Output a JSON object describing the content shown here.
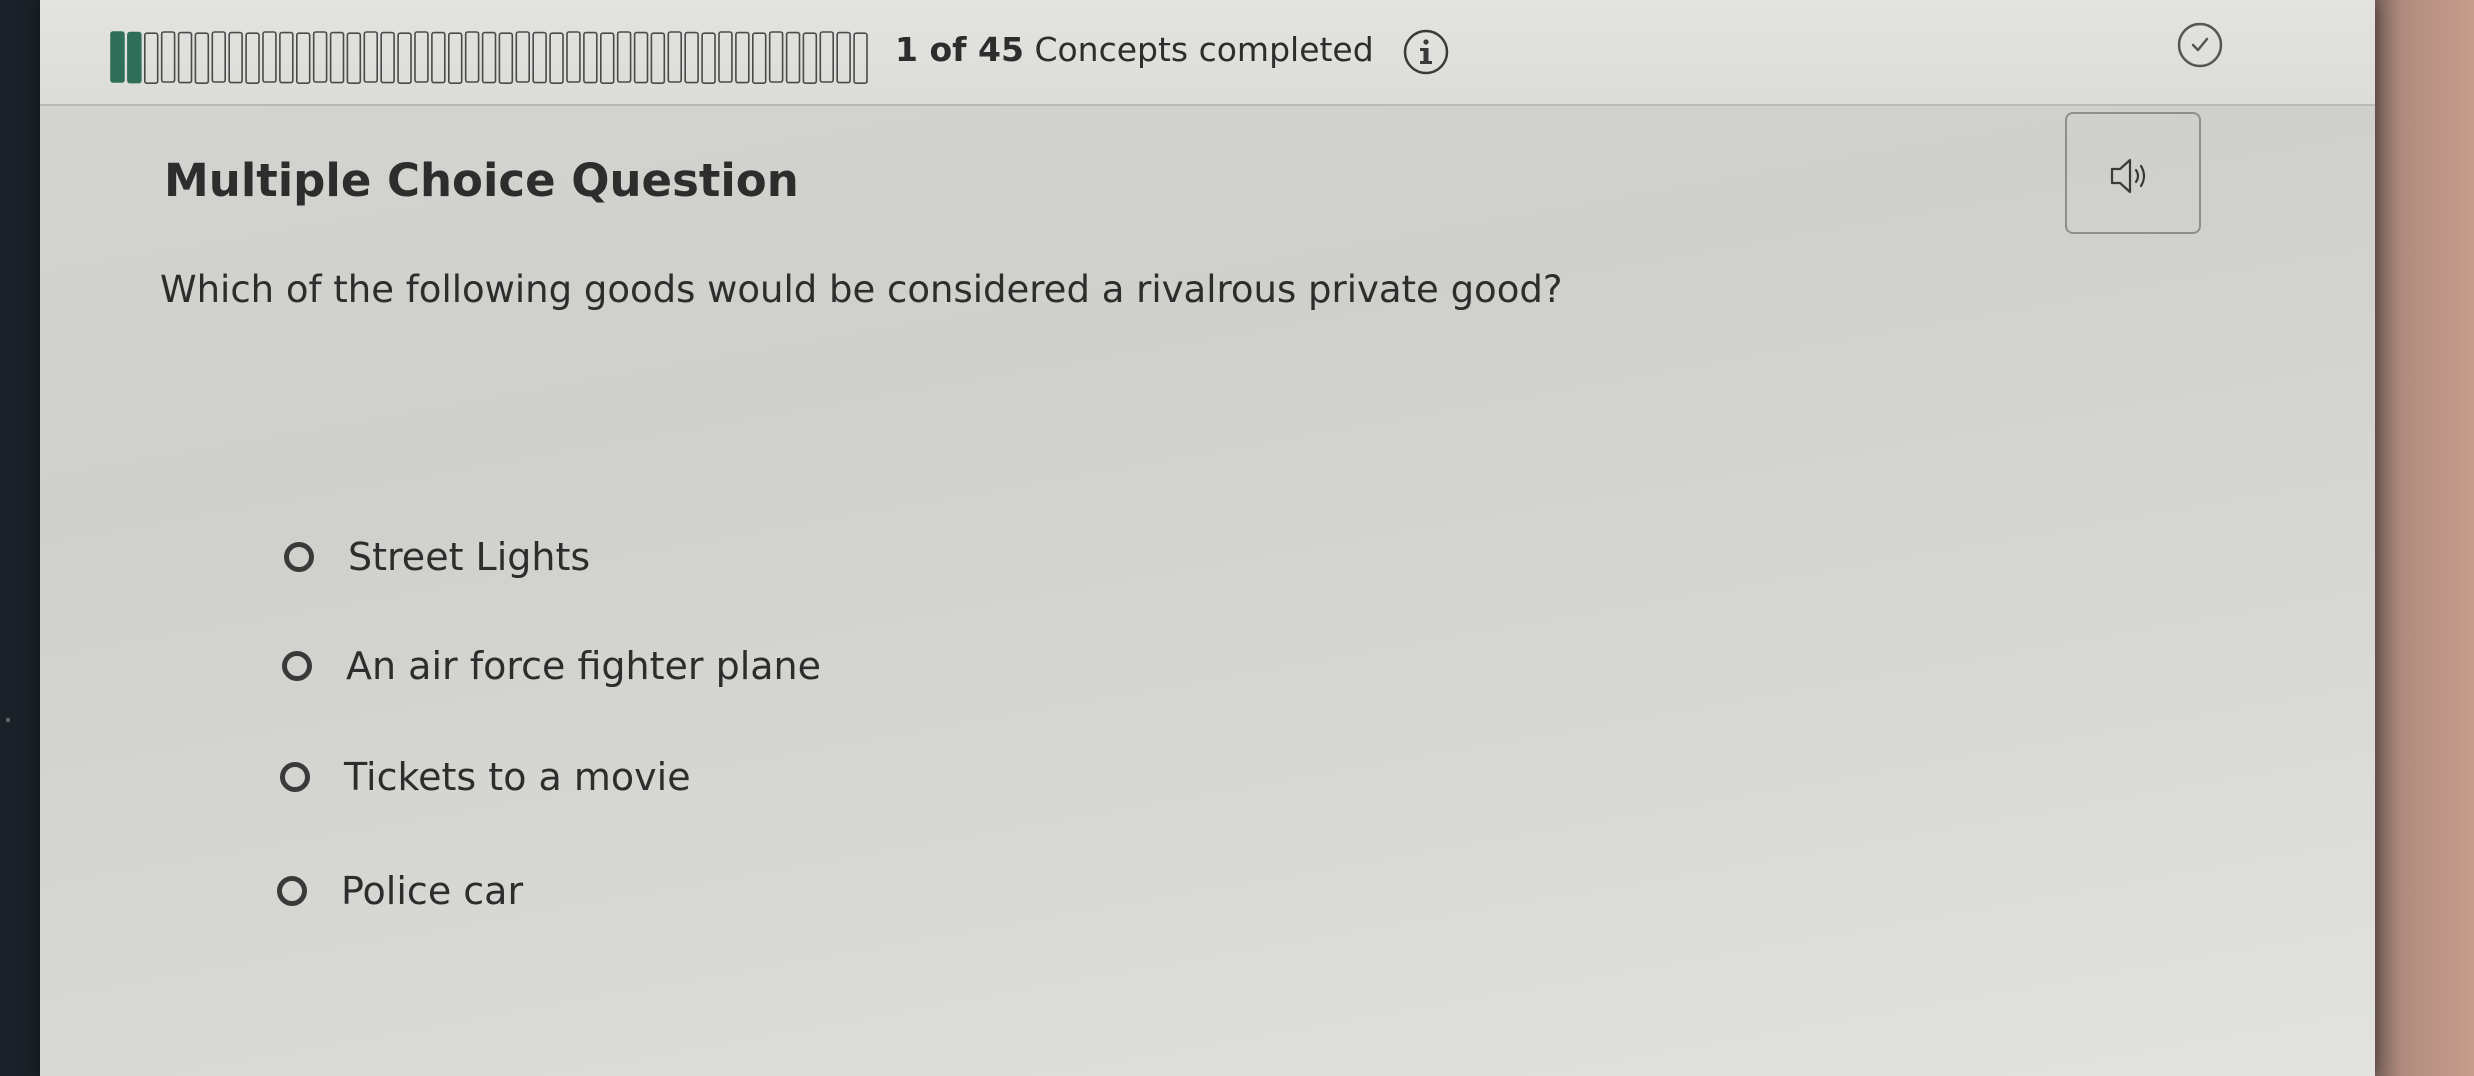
{
  "header": {
    "progress": {
      "completed_count": "1",
      "of_label": "of",
      "total": "45",
      "suffix": "Concepts completed",
      "fraction": 0.0222
    },
    "info_icon": "info-icon",
    "check_icon": "check-circle-icon"
  },
  "audio": {
    "icon": "speaker-icon"
  },
  "question": {
    "type": "Multiple Choice Question",
    "text": "Which of the following goods would be considered a rivalrous private good?",
    "options": [
      {
        "label": "Street Lights"
      },
      {
        "label": "An air force fighter plane"
      },
      {
        "label": "Tickets to a movie"
      },
      {
        "label": "Police car"
      }
    ]
  },
  "colors": {
    "progress_fill": "#2f6f5a",
    "text": "#2d2d2d",
    "background": "#d4d4d2"
  }
}
